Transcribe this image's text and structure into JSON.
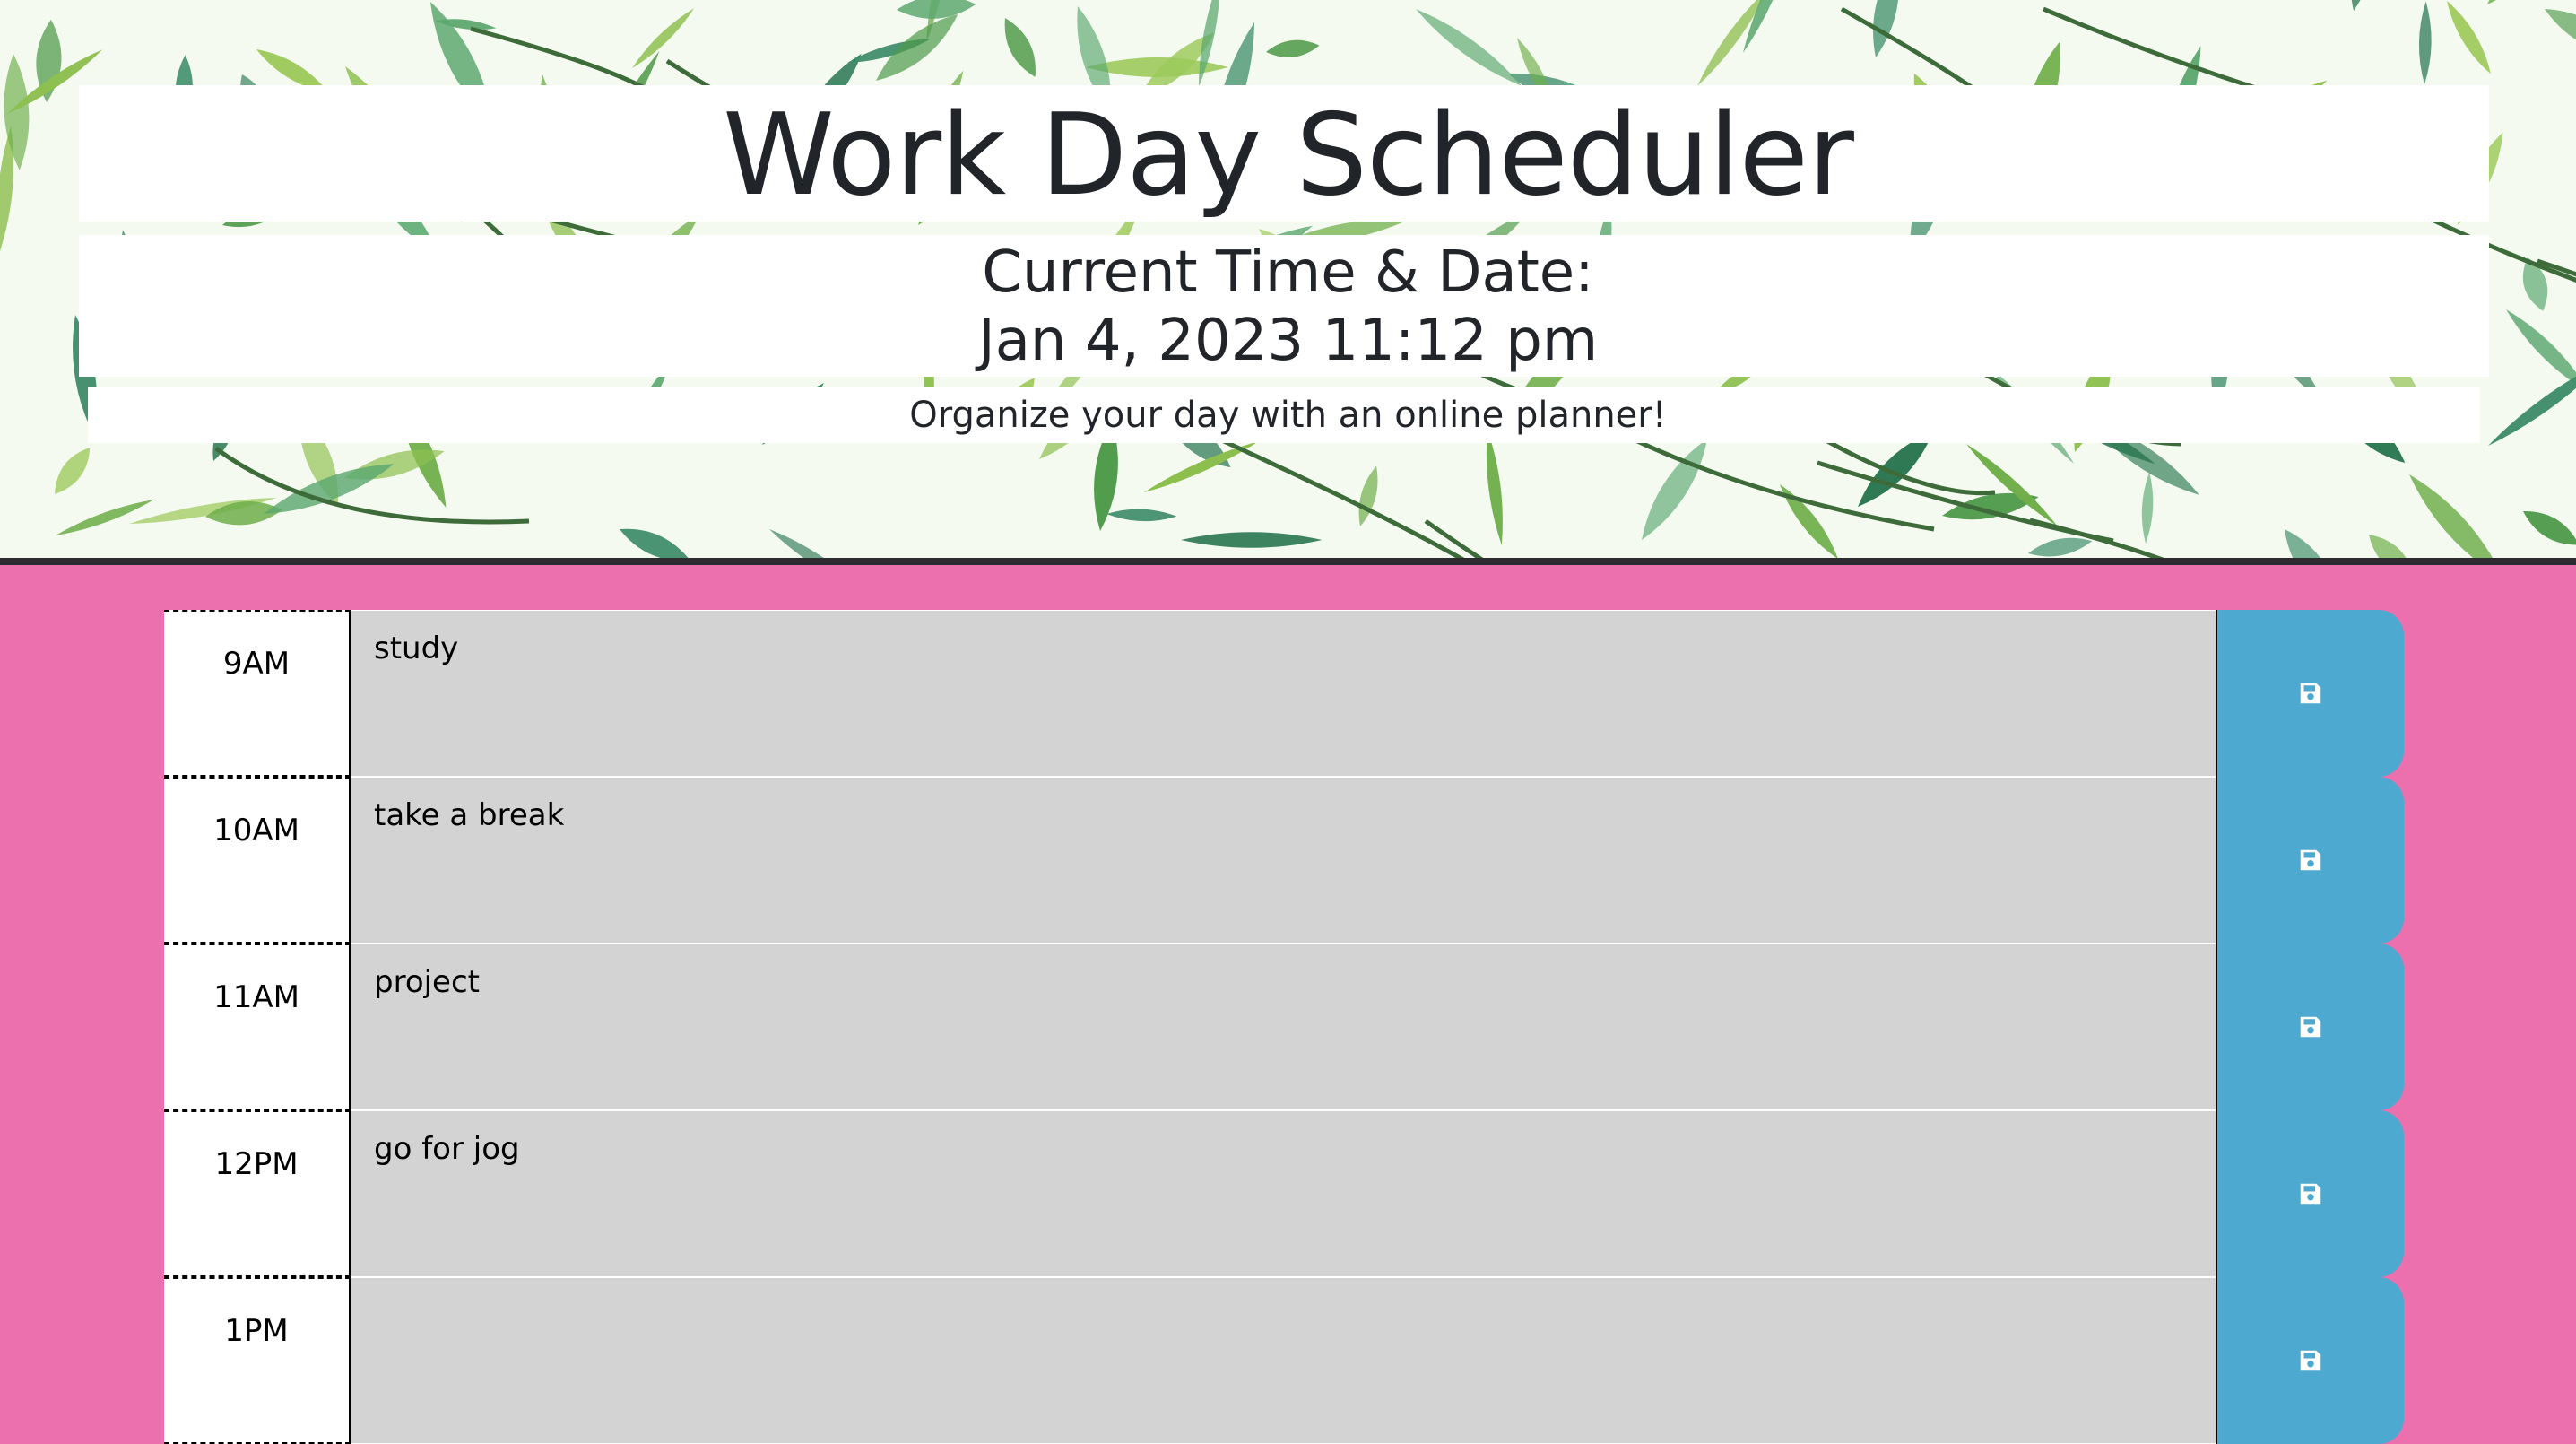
{
  "header": {
    "title": "Work Day Scheduler",
    "time_label": "Current Time & Date:",
    "current_datetime": "Jan 4, 2023 11:12 pm",
    "lead": "Organize your day with an online planner!"
  },
  "colors": {
    "page_background": "#ed70ae",
    "hour_cell": "#ffffff",
    "description_field": "#d3d3d3",
    "save_button": "#4ea9d1",
    "text": "#212529"
  },
  "schedule": {
    "rows": [
      {
        "hour": "9AM",
        "text": "study",
        "save_icon": "floppy-disk-icon"
      },
      {
        "hour": "10AM",
        "text": "take a break",
        "save_icon": "floppy-disk-icon"
      },
      {
        "hour": "11AM",
        "text": "project",
        "save_icon": "floppy-disk-icon"
      },
      {
        "hour": "12PM",
        "text": "go for jog",
        "save_icon": "floppy-disk-icon"
      },
      {
        "hour": "1PM",
        "text": "",
        "save_icon": "floppy-disk-icon"
      }
    ]
  }
}
